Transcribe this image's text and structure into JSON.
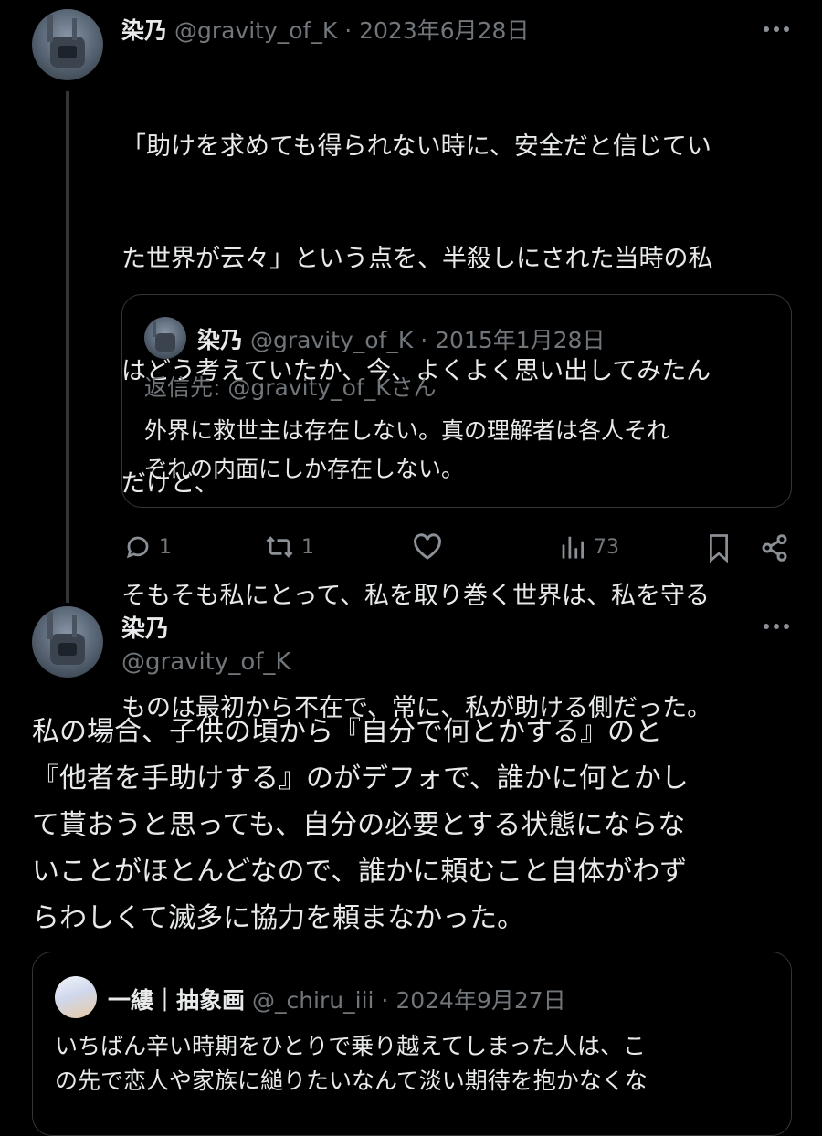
{
  "tweet1": {
    "name": "染乃",
    "handle": "@gravity_of_K",
    "separator": "·",
    "date": "2023年6月28日",
    "lines": [
      "「助けを求めても得られない時に、安全だと信じてい",
      "た世界が云々」という点を、半殺しにされた当時の私",
      "はどう考えていたか、今、よくよく思い出してみたん",
      "だけど、",
      "そもそも私にとって、私を取り巻く世界は、私を守る",
      "ものは最初から不在で、常に、私が助ける側だった。"
    ],
    "quote": {
      "name": "染乃",
      "handle": "@gravity_of_K",
      "separator": "·",
      "date": "2015年1月28日",
      "reply_to": "返信先: @gravity_of_Kさん",
      "lines": [
        "外界に救世主は存在しない。真の理解者は各人それ",
        "ぞれの内面にしか存在しない。"
      ]
    },
    "actions": {
      "replies": "1",
      "retweets": "1",
      "views": "73"
    }
  },
  "tweet2": {
    "name": "染乃",
    "handle": "@gravity_of_K",
    "lines": [
      "私の場合、子供の頃から『自分で何とかする』のと",
      "『他者を手助けする』のがデフォで、誰かに何とかし",
      "て貰おうと思っても、自分の必要とする状態にならな",
      "いことがほとんどなので、誰かに頼むこと自体がわず",
      "らわしくて滅多に協力を頼まなかった。"
    ],
    "quote": {
      "name": "一縷｜抽象画",
      "handle": "@_chiru_iii",
      "separator": "·",
      "date": "2024年9月27日",
      "lines": [
        "いちばん辛い時期をひとりで乗り越えてしまった人は、こ",
        "の先で恋人や家族に縋りたいなんて淡い期待を抱かなくな"
      ]
    }
  },
  "icons": {
    "reply": "reply-icon",
    "retweet": "retweet-icon",
    "like": "heart-icon",
    "views": "views-icon",
    "bookmark": "bookmark-icon",
    "share": "share-icon",
    "more": "more-icon"
  },
  "colors": {
    "background": "#000000",
    "text": "#e7e9ea",
    "muted": "#71767b",
    "border": "#333639"
  }
}
